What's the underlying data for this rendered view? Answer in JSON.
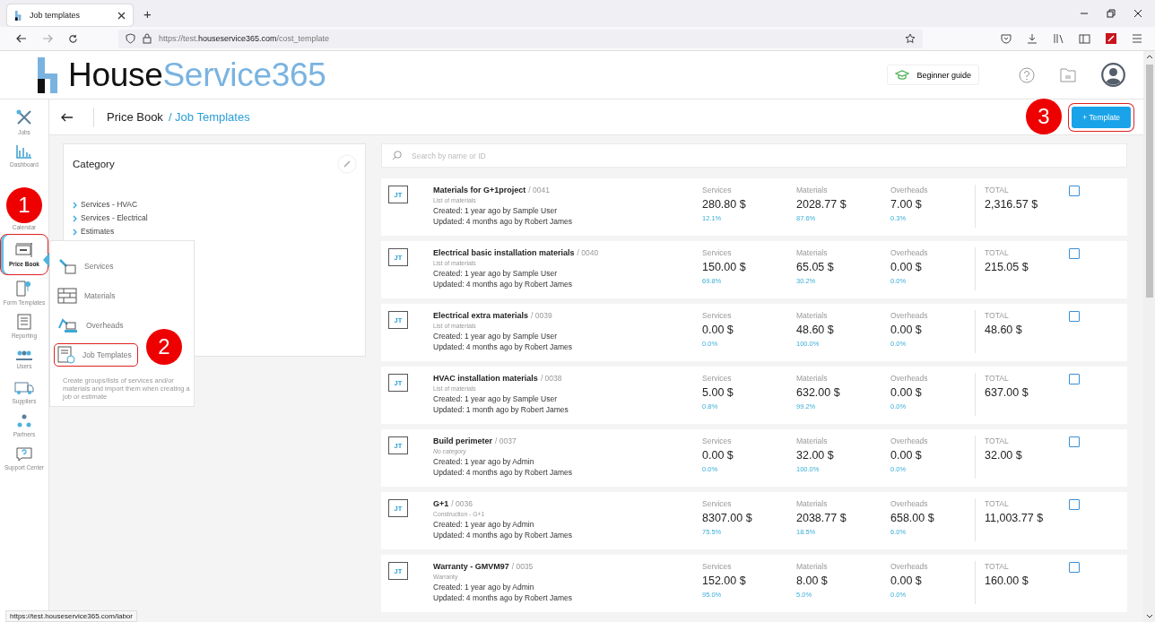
{
  "browser": {
    "tab_title": "Job templates",
    "new_tab": "+",
    "url_scheme": "https://test.",
    "url_host": "houseservice365.com",
    "url_path": "/cost_template",
    "status_url": "https://test.houseservice365.com/labor"
  },
  "app_header": {
    "logo_dark": "House",
    "logo_light": "Service365",
    "guide_button": "Beginner guide"
  },
  "sidebar": {
    "items": [
      {
        "label": "Jobs",
        "selected": false,
        "outlined": false
      },
      {
        "label": "Dashboard",
        "selected": false,
        "outlined": false
      },
      {
        "label": "Calendar",
        "selected": false,
        "outlined": false
      },
      {
        "label": "Price Book",
        "selected": true,
        "outlined": true
      },
      {
        "label": "Form Templates",
        "selected": false,
        "outlined": false
      },
      {
        "label": "Reporting",
        "selected": false,
        "outlined": false
      },
      {
        "label": "Users",
        "selected": false,
        "outlined": false
      },
      {
        "label": "Suppliers",
        "selected": false,
        "outlined": false
      },
      {
        "label": "Partners",
        "selected": false,
        "outlined": false
      },
      {
        "label": "Support Center",
        "selected": false,
        "outlined": false
      }
    ]
  },
  "flyout_menu": {
    "items": [
      {
        "label": "Services",
        "outlined": false
      },
      {
        "label": "Materials",
        "outlined": false
      },
      {
        "label": "Overheads",
        "outlined": false
      },
      {
        "label": "Job Templates",
        "outlined": true
      }
    ],
    "description": "Create groups/lists of services and/or materials and import them when creating a job or estimate"
  },
  "page_header": {
    "crumb_parent": "Price Book",
    "crumb_current": "/ Job Templates",
    "add_button": "+ Template",
    "add_button_outlined": true
  },
  "category_panel": {
    "title": "Category",
    "items": [
      {
        "label": "Services - HVAC"
      },
      {
        "label": "Services - Electrical"
      },
      {
        "label": "Estimates"
      }
    ]
  },
  "search": {
    "placeholder": "Search by name or ID"
  },
  "templates": [
    {
      "badge": "JT",
      "title": "Materials for G+1project",
      "code": "/ 0041",
      "category": "List of materials",
      "no_category": false,
      "created": "Created: 1 year ago by Sample User",
      "updated": "Updated: 4 months ago by Robert James",
      "services_label": "Services",
      "services": "280.80 $",
      "services_pct": "12.1%",
      "materials_label": "Materials",
      "materials": "2028.77 $",
      "materials_pct": "87.6%",
      "overheads_label": "Overheads",
      "overheads": "7.00 $",
      "overheads_pct": "0.3%",
      "total_label": "TOTAL",
      "total": "2,316.57 $",
      "checked": false
    },
    {
      "badge": "JT",
      "title": "Electrical basic installation materials",
      "code": "/ 0040",
      "category": "List of materials",
      "no_category": false,
      "created": "Created: 1 year ago by Sample User",
      "updated": "Updated: 4 months ago by Robert James",
      "services_label": "Services",
      "services": "150.00 $",
      "services_pct": "69.8%",
      "materials_label": "Materials",
      "materials": "65.05 $",
      "materials_pct": "30.2%",
      "overheads_label": "Overheads",
      "overheads": "0.00 $",
      "overheads_pct": "0.0%",
      "total_label": "TOTAL",
      "total": "215.05 $",
      "checked": false
    },
    {
      "badge": "JT",
      "title": "Electrical extra materials",
      "code": "/ 0039",
      "category": "List of materials",
      "no_category": false,
      "created": "Created: 1 year ago by Sample User",
      "updated": "Updated: 4 months ago by Robert James",
      "services_label": "Services",
      "services": "0.00 $",
      "services_pct": "0.0%",
      "materials_label": "Materials",
      "materials": "48.60 $",
      "materials_pct": "100.0%",
      "overheads_label": "Overheads",
      "overheads": "0.00 $",
      "overheads_pct": "0.0%",
      "total_label": "TOTAL",
      "total": "48.60 $",
      "checked": false
    },
    {
      "badge": "JT",
      "title": "HVAC installation materials",
      "code": "/ 0038",
      "category": "List of materials",
      "no_category": false,
      "created": "Created: 1 year ago by Sample User",
      "updated": "Updated: 1 month ago by Robert James",
      "services_label": "Services",
      "services": "5.00 $",
      "services_pct": "0.8%",
      "materials_label": "Materials",
      "materials": "632.00 $",
      "materials_pct": "99.2%",
      "overheads_label": "Overheads",
      "overheads": "0.00 $",
      "overheads_pct": "0.0%",
      "total_label": "TOTAL",
      "total": "637.00 $",
      "checked": false
    },
    {
      "badge": "JT",
      "title": "Build perimeter",
      "code": "/ 0037",
      "category": "No category",
      "no_category": true,
      "created": "Created: 1 year ago by Admin",
      "updated": "Updated: 4 months ago by Robert James",
      "services_label": "Services",
      "services": "0.00 $",
      "services_pct": "0.0%",
      "materials_label": "Materials",
      "materials": "32.00 $",
      "materials_pct": "100.0%",
      "overheads_label": "Overheads",
      "overheads": "0.00 $",
      "overheads_pct": "0.0%",
      "total_label": "TOTAL",
      "total": "32.00 $",
      "checked": false
    },
    {
      "badge": "JT",
      "title": "G+1",
      "code": "/ 0036",
      "category": "Construction - G+1",
      "no_category": false,
      "created": "Created: 1 year ago by Admin",
      "updated": "Updated: 4 months ago by Robert James",
      "services_label": "Services",
      "services": "8307.00 $",
      "services_pct": "75.5%",
      "materials_label": "Materials",
      "materials": "2038.77 $",
      "materials_pct": "18.5%",
      "overheads_label": "Overheads",
      "overheads": "658.00 $",
      "overheads_pct": "6.0%",
      "total_label": "TOTAL",
      "total": "11,003.77 $",
      "checked": false
    },
    {
      "badge": "JT",
      "title": "Warranty - GMVM97",
      "code": "/ 0035",
      "category": "Warranty",
      "no_category": false,
      "created": "Created: 1 year ago by Admin",
      "updated": "Updated: 4 months ago by Robert James",
      "services_label": "Services",
      "services": "152.00 $",
      "services_pct": "95.0%",
      "materials_label": "Materials",
      "materials": "8.00 $",
      "materials_pct": "5.0%",
      "overheads_label": "Overheads",
      "overheads": "0.00 $",
      "overheads_pct": "0.0%",
      "total_label": "TOTAL",
      "total": "160.00 $",
      "checked": false
    }
  ],
  "callouts": [
    {
      "label": "1"
    },
    {
      "label": "2"
    },
    {
      "label": "3"
    }
  ]
}
